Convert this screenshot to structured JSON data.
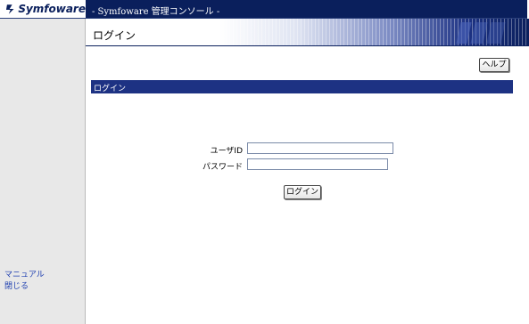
{
  "header": {
    "logo_text": "Symfoware",
    "app_title": "- Symfoware 管理コンソール -"
  },
  "sidebar": {
    "manual_label": "マニュアル",
    "close_label": "閉じる"
  },
  "page": {
    "title": "ログイン",
    "help_label": "ヘルプ"
  },
  "section": {
    "title": "ログイン"
  },
  "form": {
    "user_id_label": "ユーザID",
    "user_id_value": "",
    "password_label": "パスワード",
    "password_value": "",
    "login_label": "ログイン"
  },
  "colors": {
    "banner": "#0a1f5c",
    "section_bar": "#1d3283",
    "link": "#1e3fb0",
    "sidebar_bg": "#e8e8e8"
  }
}
